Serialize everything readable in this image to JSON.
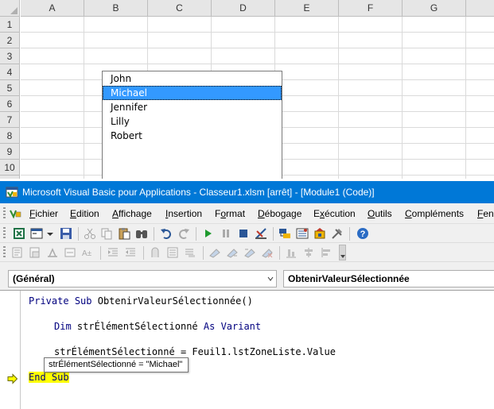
{
  "excel": {
    "columns": [
      "A",
      "B",
      "C",
      "D",
      "E",
      "F",
      "G"
    ],
    "rows": [
      "1",
      "2",
      "3",
      "4",
      "5",
      "6",
      "7",
      "8",
      "9",
      "10"
    ],
    "listbox": {
      "items": [
        "John",
        "Michael",
        "Jennifer",
        "Lilly",
        "Robert"
      ],
      "selected": "Michael"
    }
  },
  "vbe": {
    "title": "Microsoft Visual Basic pour Applications - Classeur1.xlsm [arrêt] - [Module1 (Code)]",
    "menu": [
      {
        "pre": "",
        "key": "F",
        "post": "ichier"
      },
      {
        "pre": "",
        "key": "E",
        "post": "dition"
      },
      {
        "pre": "",
        "key": "A",
        "post": "ffichage"
      },
      {
        "pre": "",
        "key": "I",
        "post": "nsertion"
      },
      {
        "pre": "F",
        "key": "o",
        "post": "rmat"
      },
      {
        "pre": "",
        "key": "D",
        "post": "ébogage"
      },
      {
        "pre": "E",
        "key": "x",
        "post": "écution"
      },
      {
        "pre": "",
        "key": "O",
        "post": "utils"
      },
      {
        "pre": "",
        "key": "C",
        "post": "ompléments"
      },
      {
        "pre": "",
        "key": "F",
        "post": "ene"
      }
    ],
    "object_combo": "(Général)",
    "procedure_combo": "ObtenirValeurSélectionnée",
    "code": {
      "line1_kw1": "Private",
      "line1_kw2": "Sub",
      "line1_rest": "ObtenirValeurSélectionnée()",
      "line2_kw1": "Dim",
      "line2_mid": "strÉlémentSélectionné",
      "line2_kw2": "As",
      "line2_rest": "Variant",
      "line3": "strÉlémentSélectionné = Feuil1.lstZoneListe.Value",
      "line4": "End Sub"
    },
    "tooltip": "strÉlémentSélectionné = \"Michael\"",
    "colors": {
      "titlebar": "#0078d7",
      "keyword": "#00007f",
      "current_line_highlight": "#ffff00",
      "listbox_selection": "#3399ff"
    }
  }
}
